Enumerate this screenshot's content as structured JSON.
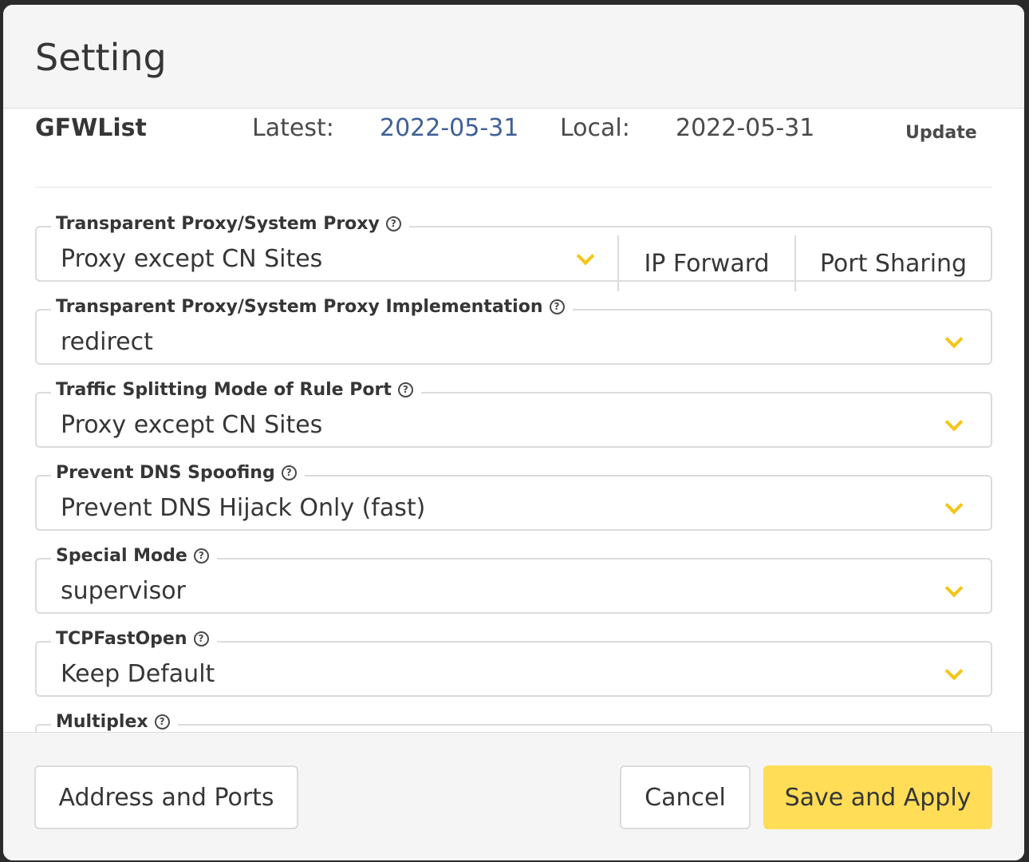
{
  "dialog": {
    "title": "Setting"
  },
  "gfwlist": {
    "name": "GFWList",
    "latest_label": "Latest:",
    "latest_value": "2022-05-31",
    "local_label": "Local:",
    "local_value": "2022-05-31",
    "update_label": "Update"
  },
  "fields": {
    "proxy_mode": {
      "label": "Transparent Proxy/System Proxy",
      "value": "Proxy except CN Sites",
      "ip_forward_label": "IP Forward",
      "port_sharing_label": "Port Sharing"
    },
    "implementation": {
      "label": "Transparent Proxy/System Proxy Implementation",
      "value": "redirect"
    },
    "rule_port_mode": {
      "label": "Traffic Splitting Mode of Rule Port",
      "value": "Proxy except CN Sites"
    },
    "dns_spoofing": {
      "label": "Prevent DNS Spoofing",
      "value": "Prevent DNS Hijack Only (fast)"
    },
    "special_mode": {
      "label": "Special Mode",
      "value": "supervisor"
    },
    "tcp_fast_open": {
      "label": "TCPFastOpen",
      "value": "Keep Default"
    },
    "multiplex": {
      "label": "Multiplex"
    }
  },
  "help_glyph": "?",
  "footer": {
    "address_ports_label": "Address and Ports",
    "cancel_label": "Cancel",
    "save_apply_label": "Save and Apply"
  },
  "colors": {
    "accent": "#ffdd57",
    "chevron": "#f5c518",
    "link": "#3e5f96"
  }
}
